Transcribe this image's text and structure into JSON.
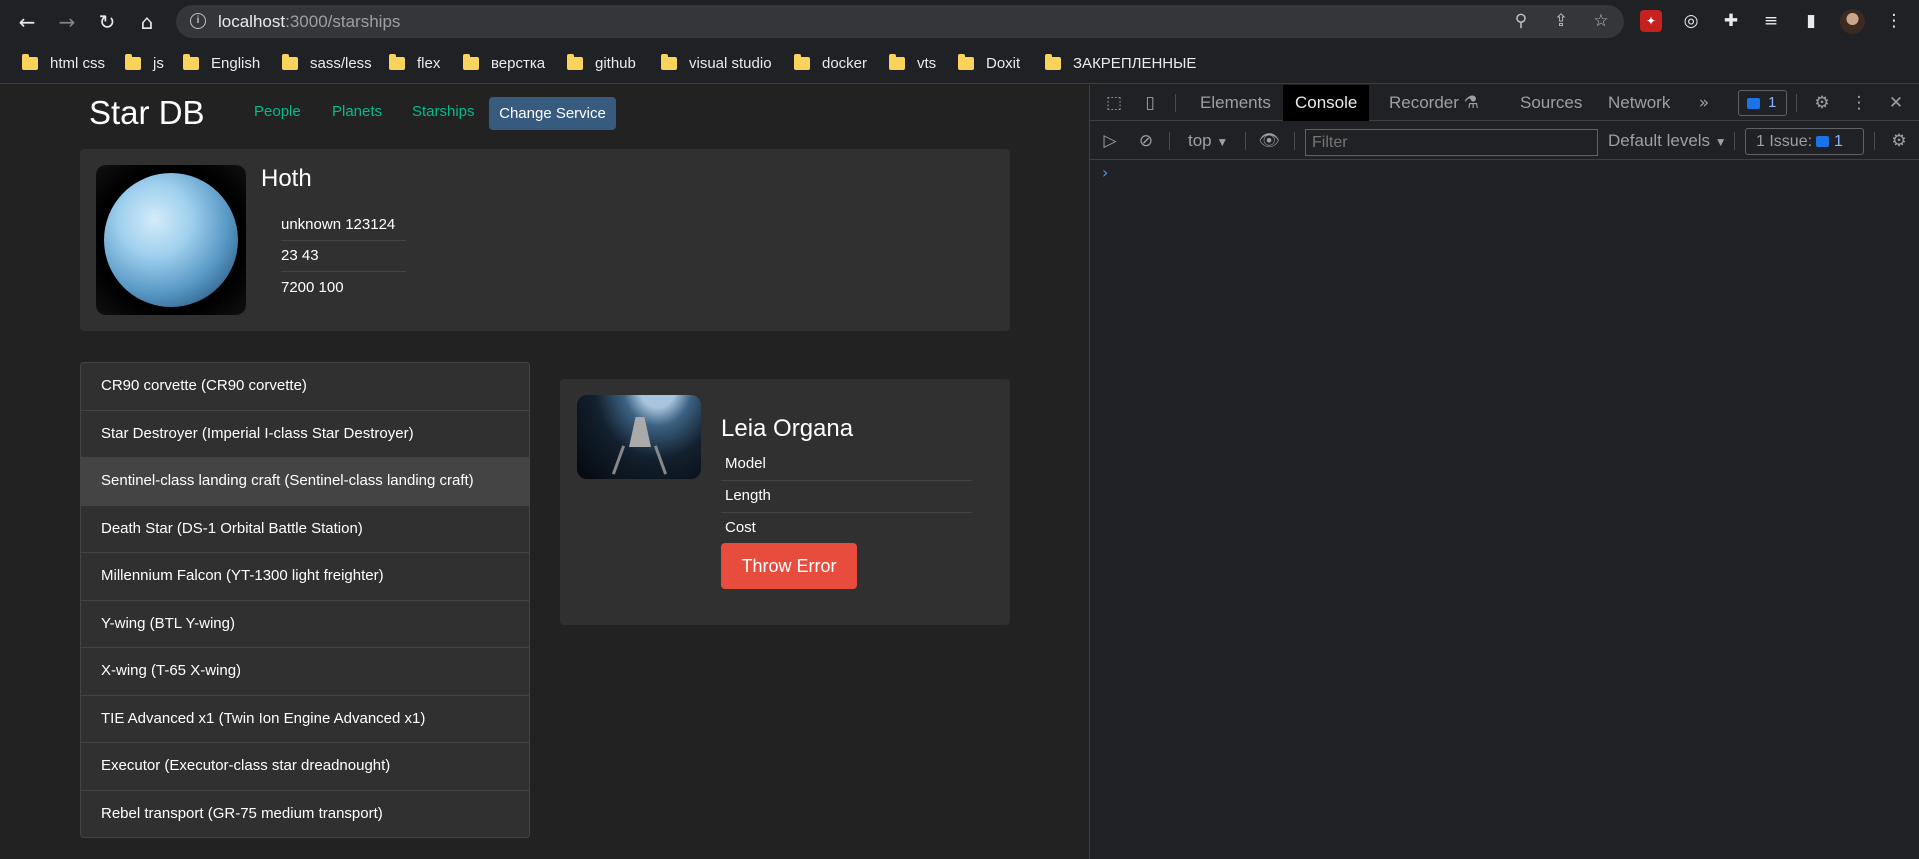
{
  "browser": {
    "url_host": "localhost",
    "url_path": ":3000/starships",
    "bookmarks": [
      "html css",
      "js",
      "English",
      "sass/less",
      "flex",
      "верстка",
      "github",
      "visual studio",
      "docker",
      "vts",
      "Doxit",
      "ЗАКРЕПЛЕННЫЕ"
    ]
  },
  "app": {
    "brand": "Star DB",
    "nav": [
      "People",
      "Planets",
      "Starships"
    ],
    "change_service": "Change Service"
  },
  "planet": {
    "name": "Hoth",
    "rows": [
      "unknown  123124",
      "23  43",
      "7200  100"
    ]
  },
  "list": [
    "CR90 corvette (CR90 corvette)",
    "Star Destroyer (Imperial I-class Star Destroyer)",
    "Sentinel-class landing craft (Sentinel-class landing craft)",
    "Death Star (DS-1 Orbital Battle Station)",
    "Millennium Falcon (YT-1300 light freighter)",
    "Y-wing (BTL Y-wing)",
    "X-wing (T-65 X-wing)",
    "TIE Advanced x1 (Twin Ion Engine Advanced x1)",
    "Executor (Executor-class star dreadnought)",
    "Rebel transport (GR-75 medium transport)"
  ],
  "details": {
    "name": "Leia Organa",
    "rows": [
      "Model",
      "Length",
      "Cost"
    ],
    "throw_label": "Throw Error"
  },
  "devtools": {
    "tabs": [
      "Elements",
      "Console",
      "Recorder",
      "Sources",
      "Network"
    ],
    "badge_count": "1",
    "context": "top",
    "filter_placeholder": "Filter",
    "levels": "Default levels",
    "issues_label": "1 Issue:",
    "issues_count": "1",
    "prompt": "›"
  }
}
